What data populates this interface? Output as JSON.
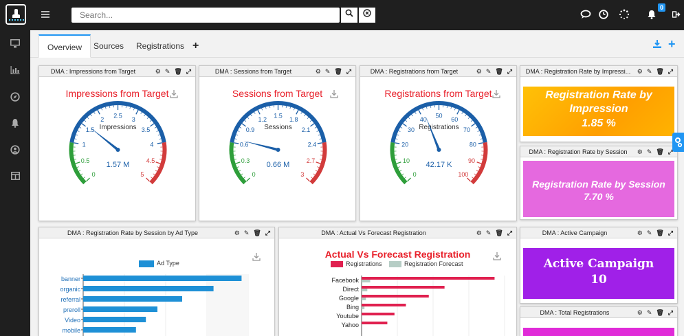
{
  "search": {
    "placeholder": "Search..."
  },
  "notifications": {
    "count": "0"
  },
  "tabs": [
    {
      "label": "Overview"
    },
    {
      "label": "Sources"
    },
    {
      "label": "Registrations"
    }
  ],
  "panels": {
    "impressions": {
      "header": "DMA : Impressions from Target",
      "title": "Impressions from Target",
      "gauge_label": "Impressions",
      "value": "1.57 M",
      "ticks": [
        "0",
        "0.5",
        "1",
        "1.5",
        "2",
        "2.5",
        "3",
        "3.5",
        "4",
        "4.5",
        "5"
      ]
    },
    "sessions": {
      "header": "DMA : Sessions from Target",
      "title": "Sessions from Target",
      "gauge_label": "Sessions",
      "value": "0.66 M",
      "ticks": [
        "0",
        "0.3",
        "0.6",
        "0.9",
        "1.2",
        "1.5",
        "1.8",
        "2.1",
        "2.4",
        "2.7",
        "3"
      ]
    },
    "registrations": {
      "header": "DMA : Registrations from Target",
      "title": "Registrations from Target",
      "gauge_label": "Registrations",
      "value": "42.17 K",
      "ticks": [
        "0",
        "10",
        "20",
        "30",
        "40",
        "50",
        "60",
        "70",
        "80",
        "90",
        "100"
      ]
    },
    "rate_impression": {
      "header": "DMA : Registration Rate by Impressi...",
      "line1": "Registration Rate by",
      "line2": "Impression",
      "value": "1.85 %"
    },
    "rate_session": {
      "header": "DMA : Registration Rate by Session",
      "line1": "Registration Rate by Session",
      "value": "7.70 %"
    },
    "ad_type": {
      "header": "DMA : Registration Rate by Session by Ad Type",
      "legend": "Ad Type"
    },
    "forecast": {
      "header": "DMA : Actual Vs Forecast Registration",
      "title": "Actual Vs Forecast Registration",
      "legend1": "Registrations",
      "legend2": "Registration Forecast"
    },
    "active": {
      "header": "DMA : Active Campaign",
      "line1": "Active Campaign",
      "value": "10"
    },
    "total": {
      "header": "DMA : Total Registrations"
    }
  },
  "gauges": [
    {
      "id": "impressions",
      "needle_fraction": 0.31
    },
    {
      "id": "sessions",
      "needle_fraction": 0.22
    },
    {
      "id": "registrations",
      "needle_fraction": 0.42
    }
  ],
  "chart_data": [
    {
      "type": "bar",
      "orientation": "horizontal",
      "categories": [
        "banner",
        "organic",
        "referral",
        "preroll",
        "Video",
        "mobile"
      ],
      "series": [
        {
          "name": "Ad Type",
          "values": [
            0.96,
            0.79,
            0.6,
            0.45,
            0.38,
            0.32
          ]
        }
      ],
      "color": "#1e90d6"
    },
    {
      "type": "bar",
      "orientation": "horizontal",
      "title": "Actual Vs Forecast Registration",
      "categories": [
        "Facebook",
        "Direct",
        "Google",
        "Bing",
        "Youtube",
        "Yahoo"
      ],
      "series": [
        {
          "name": "Registrations",
          "values": [
            0.93,
            0.58,
            0.47,
            0.31,
            0.23,
            0.18
          ]
        },
        {
          "name": "Registration Forecast",
          "values": [
            0.06,
            0.04,
            0.03,
            0.02,
            0.0,
            0.0
          ]
        }
      ],
      "colors": [
        "#e0204f",
        "#b6cdc5"
      ]
    }
  ],
  "colors": {
    "accent": "#2196f3",
    "gauge_blue": "#1b5fa8",
    "gauge_green": "#2e9e3a",
    "gauge_red": "#d23b3b"
  }
}
